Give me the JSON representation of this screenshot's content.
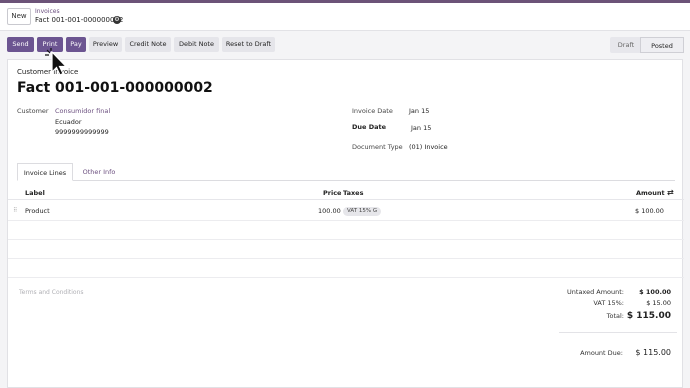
{
  "topbar": {
    "new_label": "New",
    "breadcrumb_parent": "Invoices",
    "breadcrumb_current": "Fact 001-001-000000002",
    "gear_icon": "gear-icon"
  },
  "actions": {
    "send": "Send",
    "print": "Print",
    "pay": "Pay",
    "preview": "Preview",
    "credit_note": "Credit Note",
    "debit_note": "Debit Note",
    "reset_to_draft": "Reset to Draft"
  },
  "statusbar": {
    "draft": "Draft",
    "posted": "Posted",
    "current": "Posted"
  },
  "invoice": {
    "type_label": "Customer Invoice",
    "number": "Fact 001-001-000000002",
    "customer_label": "Customer",
    "customer_name": "Consumidor final",
    "customer_country": "Ecuador",
    "customer_vat": "9999999999999",
    "invoice_date_label": "Invoice Date",
    "invoice_date": "Jan 15",
    "due_date_label": "Due Date",
    "due_date": "Jan 15",
    "document_type_label": "Document Type",
    "document_type": "(01) Invoice"
  },
  "tabs": {
    "lines": "Invoice Lines",
    "other": "Other Info"
  },
  "lines_table": {
    "headers": {
      "label": "Label",
      "price": "Price",
      "taxes": "Taxes",
      "amount": "Amount"
    },
    "rows": [
      {
        "label": "Product",
        "price": "100.00",
        "tax": "VAT 15% G",
        "amount": "$ 100.00"
      }
    ]
  },
  "footer": {
    "terms_placeholder": "Terms and Conditions",
    "untaxed_label": "Untaxed Amount:",
    "untaxed_value": "$ 100.00",
    "vat_label": "VAT 15%:",
    "vat_value": "$ 15.00",
    "total_label": "Total:",
    "total_value": "$ 115.00",
    "amount_due_label": "Amount Due:",
    "amount_due_value": "$ 115.00"
  },
  "colors": {
    "brand": "#6c5378",
    "primary_button": "#6c5591",
    "link": "#6b4f7f"
  }
}
